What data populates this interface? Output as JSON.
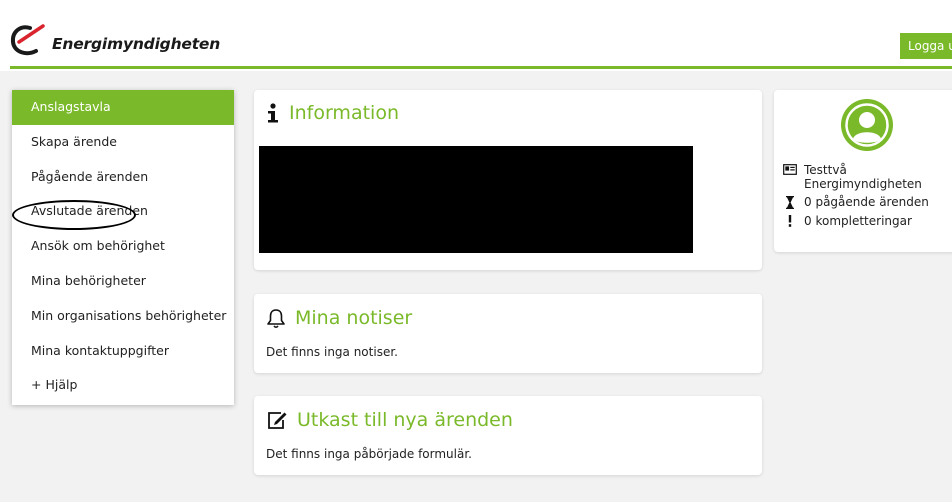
{
  "header": {
    "logo_text": "Energimyndigheten",
    "logout_label": "Logga ut"
  },
  "sidebar": {
    "items": [
      {
        "label": "Anslagstavla",
        "active": true
      },
      {
        "label": "Skapa ärende",
        "active": false
      },
      {
        "label": "Pågående ärenden",
        "active": false
      },
      {
        "label": "Avslutade ärenden",
        "active": false
      },
      {
        "label": "Ansök om behörighet",
        "active": false
      },
      {
        "label": "Mina behörigheter",
        "active": false
      },
      {
        "label": "Min organisations behörigheter",
        "active": false
      },
      {
        "label": "Mina kontaktuppgifter",
        "active": false
      },
      {
        "label": "+ Hjälp",
        "active": false
      }
    ]
  },
  "info": {
    "title": "Information"
  },
  "notiser": {
    "title": "Mina notiser",
    "text": "Det finns inga notiser."
  },
  "utkast": {
    "title": "Utkast till nya ärenden",
    "text": "Det finns inga påbörjade formulär."
  },
  "profile": {
    "name": "Testtvå Energimyndigheten",
    "ongoing": "0 pågående ärenden",
    "completions": "0 kompletteringar"
  },
  "colors": {
    "accent": "#7ab929",
    "background": "#f2f2f2"
  },
  "icons": [
    "energimyndigheten-logo-icon",
    "info-icon",
    "bell-icon",
    "edit-icon",
    "user-avatar-icon",
    "id-card-icon",
    "hourglass-icon",
    "exclamation-icon"
  ]
}
